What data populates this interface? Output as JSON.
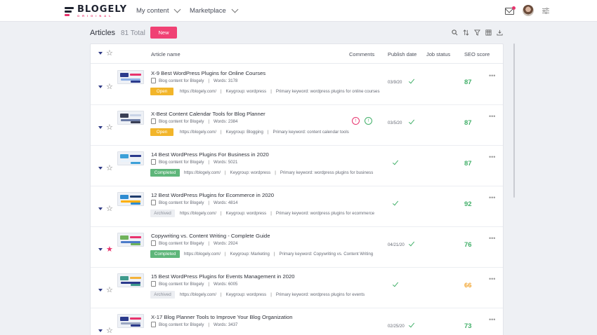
{
  "nav": {
    "logo_main": "BLOGELY",
    "logo_sub": "ORIGINAL",
    "menu": [
      "My content",
      "Marketplace"
    ]
  },
  "header": {
    "title": "Articles",
    "total": "81 Total",
    "new_label": "New"
  },
  "columns": {
    "name": "Article name",
    "comments": "Comments",
    "publish": "Publish date",
    "job": "Job status",
    "seo": "SEO score"
  },
  "colors": {
    "accent": "#f04174",
    "green": "#43b06a",
    "orange": "#f2a531"
  },
  "rows": [
    {
      "title": "X-9 Best WordPress Plugins for Online Courses",
      "project": "Blog content for Blogely",
      "words": "Words: 3178",
      "status": "Open",
      "url": "https://blogely.com/",
      "keygroup": "Keygroup: wordpress",
      "keyword": "Primary keyword: wordpress plugins for online courses",
      "date": "03/9/20",
      "score": "87",
      "starred": false,
      "comments": []
    },
    {
      "title": "X-Best Content Calendar Tools for Blog Planner",
      "project": "Blog content for Blogely",
      "words": "Words: 2384",
      "status": "Open",
      "url": "https://blogely.com/",
      "keygroup": "Keygroup: Blogging",
      "keyword": "Primary keyword: content calendar tools",
      "date": "03/5/20",
      "score": "87",
      "starred": false,
      "comments": [
        "!",
        "!"
      ]
    },
    {
      "title": "14 Best WordPress Plugins For Business in 2020",
      "project": "Blog content for Blogely",
      "words": "Words: 5021",
      "status": "Completed",
      "url": "https://blogely.com/",
      "keygroup": "Keygroup: wordpress",
      "keyword": "Primary keyword: wordpress plugins for business",
      "date": "",
      "score": "87",
      "starred": false,
      "comments": []
    },
    {
      "title": "12 Best WordPress Plugins for Ecommerce in 2020",
      "project": "Blog content for Blogely",
      "words": "Words: 4814",
      "status": "Archived",
      "url": "https://blogely.com/",
      "keygroup": "Keygroup: wordpress",
      "keyword": "Primary keyword: wordpress plugins for ecommerce",
      "date": "",
      "score": "92",
      "starred": false,
      "comments": []
    },
    {
      "title": "Copywriting vs. Content Writing - Complete Guide",
      "project": "Blog content for Blogely",
      "words": "Words: 2924",
      "status": "Completed",
      "url": "https://blogely.com/",
      "keygroup": "Keygroup: Marketing",
      "keyword": "Primary keyword: Copywriting vs. Content Writing",
      "date": "04/21/20",
      "score": "76",
      "starred": true,
      "comments": []
    },
    {
      "title": "15 Best WordPress Plugins for Events Management in 2020",
      "project": "Blog content for Blogely",
      "words": "Words: 6005",
      "status": "Archived",
      "url": "https://blogely.com/",
      "keygroup": "Keygroup: wordpress",
      "keyword": "Primary keyword: wordpress plugins for events",
      "date": "",
      "score": "66",
      "starred": false,
      "comments": []
    },
    {
      "title": "X-17 Blog Planner Tools to Improve Your Blog Organization",
      "project": "Blog content for Blogely",
      "words": "Words: 3437",
      "status": "",
      "url": "",
      "keygroup": "",
      "keyword": "",
      "date": "02/25/20",
      "score": "73",
      "starred": false,
      "comments": []
    }
  ]
}
